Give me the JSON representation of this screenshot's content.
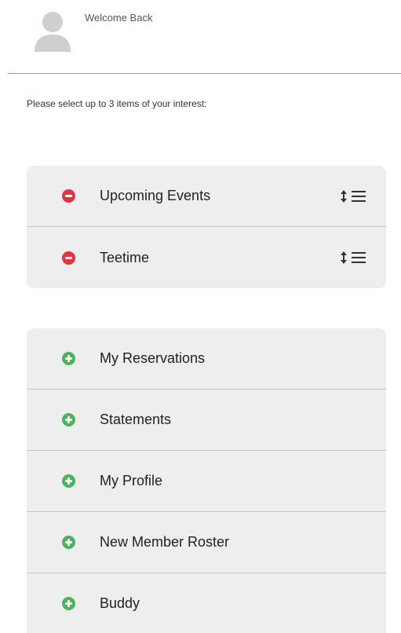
{
  "header": {
    "welcome_text": "Welcome Back",
    "avatar_icon": "user-avatar-icon"
  },
  "instruction": "Please select up to 3 items of your interest:",
  "colors": {
    "remove": "#e5323e",
    "add": "#4cb35a",
    "row_bg": "#eeeeee"
  },
  "selected_items": [
    {
      "label": "Upcoming Events",
      "action_icon": "remove-icon",
      "handle_icon": "reorder-handle-icon"
    },
    {
      "label": "Teetime",
      "action_icon": "remove-icon",
      "handle_icon": "reorder-handle-icon"
    }
  ],
  "available_items": [
    {
      "label": "My Reservations",
      "action_icon": "add-icon"
    },
    {
      "label": "Statements",
      "action_icon": "add-icon"
    },
    {
      "label": "My Profile",
      "action_icon": "add-icon"
    },
    {
      "label": "New Member Roster",
      "action_icon": "add-icon"
    },
    {
      "label": "Buddy",
      "action_icon": "add-icon"
    }
  ]
}
